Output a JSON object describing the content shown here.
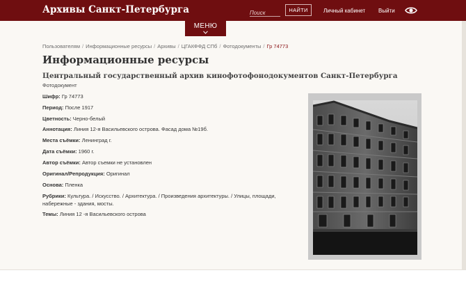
{
  "header": {
    "site_title": "Архивы Санкт-Петербурга",
    "search_placeholder": "Поиск",
    "search_button": "НАЙТИ",
    "cabinet_link": "Личный кабинет",
    "logout_link": "Выйти",
    "accessibility_icon": "eye-icon"
  },
  "menu": {
    "label": "МЕНЮ",
    "icon": "chevron-down-icon"
  },
  "breadcrumb": {
    "items": [
      "Пользователям",
      "Информационные ресурсы",
      "Архивы",
      "ЦГАКФФД СПб",
      "Фотодокументы"
    ],
    "separator": "/",
    "current": "Гр 74773"
  },
  "page": {
    "title": "Информационные ресурсы",
    "archive_name": "Центральный государственный архив кинофотофонодокументов Санкт-Петербурга",
    "doc_type": "Фотодокумент"
  },
  "fields": [
    {
      "label": "Шифр:",
      "value": "Гр 74773"
    },
    {
      "label": "Период:",
      "value": "После 1917"
    },
    {
      "label": "Цветность:",
      "value": "Черно-белый"
    },
    {
      "label": "Аннотация:",
      "value": "Линия 12-я Васильевского острова. Фасад дома №19б."
    },
    {
      "label": "Места съёмки:",
      "value": "Ленинград г."
    },
    {
      "label": "Дата съёмки:",
      "value": "1960 г."
    },
    {
      "label": "Автор съёмки:",
      "value": "Автор съемки не установлен"
    },
    {
      "label": "Оригинал/Репродукция:",
      "value": "Оригинал"
    },
    {
      "label": "Основа:",
      "value": "Пленка"
    },
    {
      "label": "Рубрики:",
      "value": "Культура. / Искусство. / Архитектура. / Произведения архитектуры. / Улицы, площади, набережные - здания, мосты."
    },
    {
      "label": "Темы:",
      "value": "Линия 12 -я Васильевского острова"
    }
  ],
  "colors": {
    "brand": "#6f0e10",
    "breadcrumb_current": "#8a1215",
    "background": "#faf8f4"
  }
}
